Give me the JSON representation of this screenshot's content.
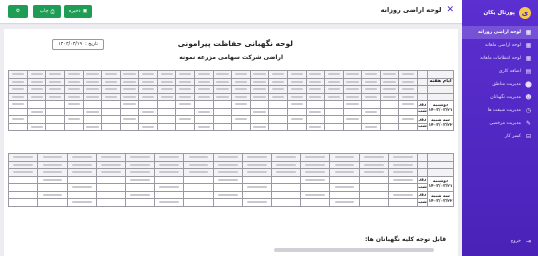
{
  "app": {
    "brand": "پورتال یکان",
    "logo_letter": "ی"
  },
  "sidebar": {
    "items": [
      {
        "label": "لوحه اراضی روزانه",
        "icon": "grid-icon",
        "glyph": "▦",
        "active": true
      },
      {
        "label": "لوحه اراضی ماهانه",
        "icon": "grid-icon",
        "glyph": "▦",
        "active": false
      },
      {
        "label": "لوحه انتظامات ماهانه",
        "icon": "grid-icon",
        "glyph": "▦",
        "active": false
      },
      {
        "label": "اضافه کاری",
        "icon": "document-icon",
        "glyph": "▤",
        "active": false
      },
      {
        "label": "مدیریت مناطق",
        "icon": "location-icon",
        "glyph": "⬤",
        "active": false
      },
      {
        "label": "مدیریت نگهبانان",
        "icon": "user-icon",
        "glyph": "☻",
        "active": false
      },
      {
        "label": "مدیریت شیفت ها",
        "icon": "shift-icon",
        "glyph": "◷",
        "active": false
      },
      {
        "label": "مدیریت مرخصی",
        "icon": "leave-icon",
        "glyph": "✎",
        "active": false
      },
      {
        "label": "کسر کار",
        "icon": "deduction-icon",
        "glyph": "⊟",
        "active": false
      }
    ],
    "logout": {
      "label": "خروج",
      "icon": "logout-icon",
      "glyph": "⇥"
    }
  },
  "topbar": {
    "title": "لوحه اراضی روزانه",
    "close_glyph": "✕",
    "save_label": "ذخیره",
    "print_label": "چاپ",
    "save_glyph": "▣",
    "print_glyph": "⎙",
    "gear_glyph": "⚙"
  },
  "document": {
    "title": "لوحه نگهبانی حفاظت پیرامونی",
    "subtitle": "اراضی شرکت سهامی مزرعه نمونه",
    "date_label": "تاریخ :",
    "date_value": "۱۴۰۳/۰۳/۱۹",
    "row_header": "ایام هفته",
    "days": [
      {
        "name": "دوشنبه",
        "date": "۱۴۰۳/۰۳/۲۱"
      },
      {
        "name": "سه شنبه",
        "date": "۱۴۰۳/۰۳/۲۲"
      }
    ],
    "shifts": [
      "روز",
      "شب"
    ],
    "footer_label": "قابل توجه کلیه نگهبانان ها:"
  },
  "colors": {
    "sidebar": "#4a22b8",
    "accent_button": "#1f9d55",
    "close": "#4a22b8"
  }
}
